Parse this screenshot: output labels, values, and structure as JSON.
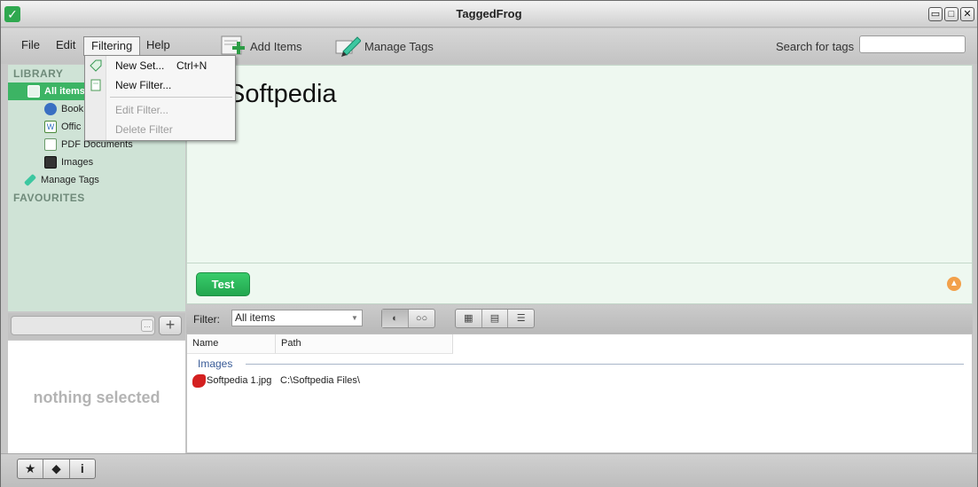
{
  "window": {
    "title": "TaggedFrog",
    "controls": {
      "minimize": "▭",
      "maximize": "□",
      "close": "✕"
    }
  },
  "menubar": {
    "file": "File",
    "edit": "Edit",
    "filtering": "Filtering",
    "help": "Help"
  },
  "toolbar": {
    "add_items": "Add Items",
    "manage_tags": "Manage Tags",
    "search_label": "Search for tags",
    "search_value": ""
  },
  "filtering_menu": {
    "items": [
      {
        "label": "New Set...",
        "shortcut": "Ctrl+N",
        "enabled": true,
        "icon": "tag-icon"
      },
      {
        "label": "New Filter...",
        "shortcut": "",
        "enabled": true,
        "icon": "document-icon"
      },
      {
        "label": "Edit Filter...",
        "shortcut": "",
        "enabled": false
      },
      {
        "label": "Delete Filter",
        "shortcut": "",
        "enabled": false
      }
    ]
  },
  "sidebar": {
    "library_title": "LIBRARY",
    "items": [
      {
        "label": "All items",
        "icon": "all-items-icon",
        "selected": true
      },
      {
        "label": "Book",
        "icon": "globe-icon",
        "selected": false
      },
      {
        "label": "Offic",
        "icon": "word-document-icon",
        "selected": false
      },
      {
        "label": "PDF Documents",
        "icon": "pdf-document-icon",
        "selected": false
      },
      {
        "label": "Images",
        "icon": "film-icon",
        "selected": false
      },
      {
        "label": "Manage Tags",
        "icon": "pen-icon",
        "selected": false
      }
    ],
    "favourites_title": "FAVOURITES",
    "tag_input_value": "",
    "tag_input_button": "...",
    "add_button": "+",
    "detail_text": "nothing selected"
  },
  "content": {
    "title": "Softpedia",
    "test_button": "Test"
  },
  "filterbar": {
    "label": "Filter:",
    "selected": "All items",
    "view_mode_1": "◐",
    "view_mode_2": "○○",
    "layout_1": "▦",
    "layout_2": "▤",
    "layout_3": "☰"
  },
  "filelist": {
    "columns": [
      "Name",
      "Path"
    ],
    "groups": [
      {
        "label": "Images",
        "rows": [
          {
            "name": "Softpedia 1.jpg",
            "path": "C:\\Softpedia Files\\"
          }
        ]
      }
    ]
  },
  "statusbar": {
    "favourite": "★",
    "tag": "⬥",
    "info": "i"
  },
  "colors": {
    "accent_green": "#3cb464",
    "sidebar_bg": "#cfe3d6",
    "content_bg": "#eef8f0",
    "group_label": "#3a5c98"
  }
}
